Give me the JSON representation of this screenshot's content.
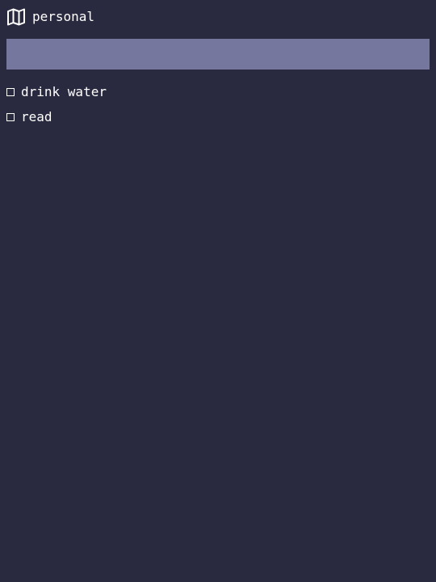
{
  "header": {
    "icon": "map-icon",
    "title": "personal"
  },
  "new_task": {
    "value": "",
    "placeholder": ""
  },
  "tasks": [
    {
      "label": "drink water",
      "checked": false
    },
    {
      "label": "read",
      "checked": false
    }
  ],
  "colors": {
    "background": "#292a3f",
    "input_background": "#76779e",
    "text": "#ffffff"
  }
}
